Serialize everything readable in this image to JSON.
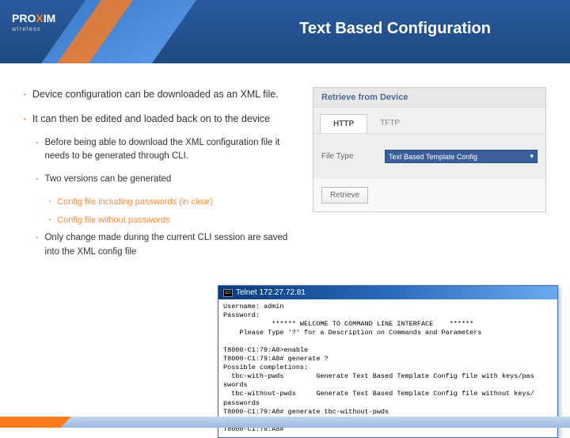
{
  "logo": {
    "brand_pre": "PRO",
    "brand_post": "IM",
    "sub": "wireless"
  },
  "title": "Text Based Configuration",
  "bullets": [
    {
      "level": 1,
      "text": "Device configuration can be downloaded as an XML file."
    },
    {
      "level": 1,
      "text": "It can then be edited and loaded back on to the device"
    },
    {
      "level": 2,
      "text": "Before being able to download the XML configuration file it needs to be generated through CLI."
    },
    {
      "level": 2,
      "text": "Two versions can be generated"
    },
    {
      "level": 3,
      "text": "Config file including passwords (in clear)"
    },
    {
      "level": 3,
      "text": "Config file without passwords"
    },
    {
      "level": 2,
      "text": "Only change made during the current CLI session are saved into the XML config file"
    }
  ],
  "panel": {
    "header": "Retrieve from Device",
    "tabs": {
      "active": "HTTP",
      "inactive": "TFTP"
    },
    "form": {
      "label": "File Type",
      "select_value": "Text Based Template Config"
    },
    "button": "Retrieve"
  },
  "terminal": {
    "title": "Telnet 172.27.72.81",
    "lines": "Username: admin\nPassword:\n            ****** WELCOME TO COMMAND LINE INTERFACE    ******\n    Please Type '?' for a Description on Commands and Parameters\n\nT8000-C1:79:A8>enable\nT8000-C1:79:A8# generate ?\nPossible completions:\n  tbc-with-pwds        Generate Text Based Template Config file with keys/pas\nswords\n  tbc-without-pwds     Generate Text Based Template Config file without keys/\npasswords\nT8000-C1:79:A8# generate tbc-without-pwds\nText Based Config Generated Successfully\nT8000-C1:79:A8#"
  }
}
